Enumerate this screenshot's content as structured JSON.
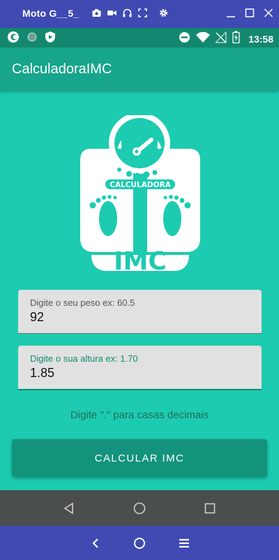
{
  "window": {
    "title": "Moto G__5_",
    "tool_icons": [
      "camera-icon",
      "video-icon",
      "headphones-icon",
      "fullscreen-icon",
      "gear-icon"
    ],
    "controls": [
      "minimize-icon",
      "maximize-icon",
      "close-icon"
    ]
  },
  "status_bar": {
    "left_icons": [
      "app-notification-icon",
      "dot-icon",
      "shield-icon"
    ],
    "right_icons": [
      "do-not-disturb-icon",
      "wifi-icon",
      "no-signal-icon",
      "battery-icon"
    ],
    "time": "13:58"
  },
  "app_bar": {
    "title": "CalculadoraIMC"
  },
  "logo": {
    "top_text": "CALCULADORA",
    "bottom_text": "IMC"
  },
  "form": {
    "weight": {
      "label": "Digite o seu peso ex: 60.5",
      "value": "92"
    },
    "height": {
      "label": "Digite o sua altura ex: 1.70",
      "value": "1.85"
    },
    "hint": "Digite \".\" para casas decimais",
    "button_label": "CALCULAR IMC"
  },
  "colors": {
    "background": "#1ccbb0",
    "app_bar": "#17a58b",
    "button": "#13937b",
    "accent": "#0f8a72"
  },
  "nav": [
    "back-icon",
    "home-icon",
    "recents-icon"
  ],
  "emulator_nav": [
    "back-chevron-icon",
    "home-circle-icon",
    "menu-icon"
  ]
}
